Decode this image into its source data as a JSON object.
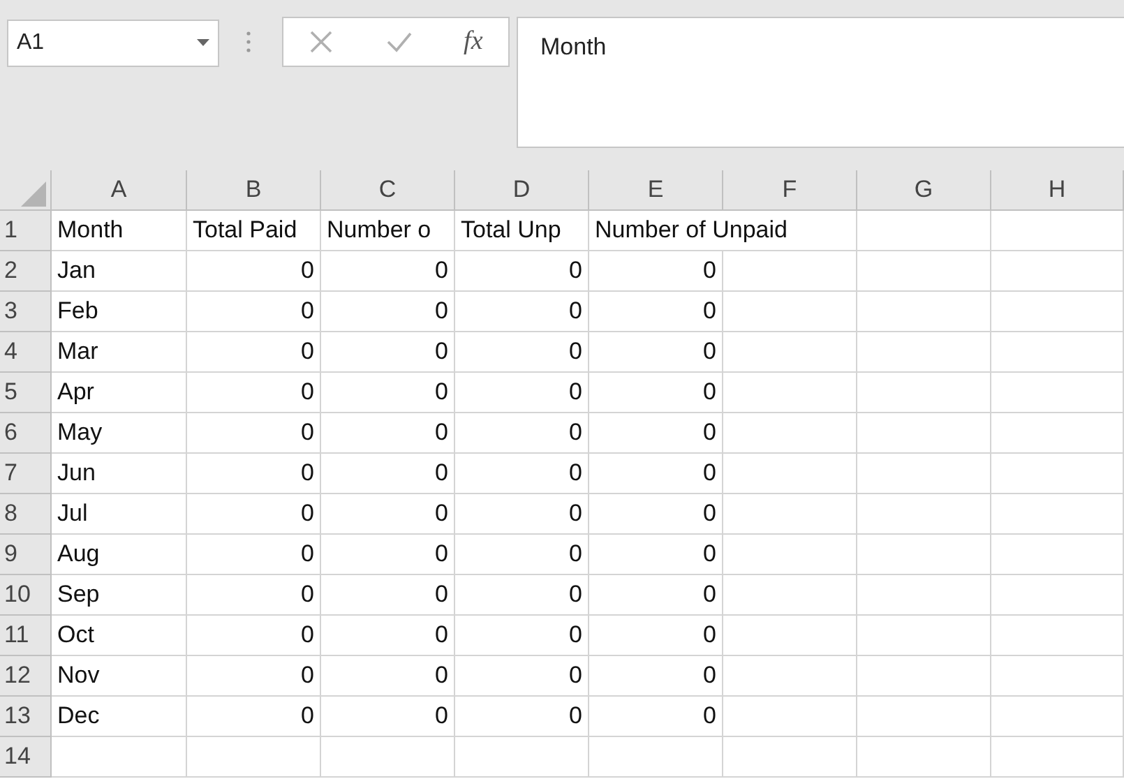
{
  "name_box": {
    "value": "A1"
  },
  "formula_bar": {
    "function_label": "fx",
    "value": "Month"
  },
  "columns": [
    "A",
    "B",
    "C",
    "D",
    "E",
    "F",
    "G",
    "H"
  ],
  "rows": [
    {
      "header": "1",
      "cells": [
        {
          "kind": "text",
          "value": "Month"
        },
        {
          "kind": "text",
          "value": "Total Paid"
        },
        {
          "kind": "text",
          "value": "Number o"
        },
        {
          "kind": "text",
          "value": "Total Unp"
        },
        {
          "kind": "text",
          "value": "Number of Unpaid"
        }
      ]
    },
    {
      "header": "2",
      "cells": [
        {
          "kind": "text",
          "value": "Jan"
        },
        {
          "kind": "number",
          "value": "0"
        },
        {
          "kind": "number",
          "value": "0"
        },
        {
          "kind": "number",
          "value": "0"
        },
        {
          "kind": "number",
          "value": "0"
        }
      ]
    },
    {
      "header": "3",
      "cells": [
        {
          "kind": "text",
          "value": "Feb"
        },
        {
          "kind": "number",
          "value": "0"
        },
        {
          "kind": "number",
          "value": "0"
        },
        {
          "kind": "number",
          "value": "0"
        },
        {
          "kind": "number",
          "value": "0"
        }
      ]
    },
    {
      "header": "4",
      "cells": [
        {
          "kind": "text",
          "value": "Mar"
        },
        {
          "kind": "number",
          "value": "0"
        },
        {
          "kind": "number",
          "value": "0"
        },
        {
          "kind": "number",
          "value": "0"
        },
        {
          "kind": "number",
          "value": "0"
        }
      ]
    },
    {
      "header": "5",
      "cells": [
        {
          "kind": "text",
          "value": "Apr"
        },
        {
          "kind": "number",
          "value": "0"
        },
        {
          "kind": "number",
          "value": "0"
        },
        {
          "kind": "number",
          "value": "0"
        },
        {
          "kind": "number",
          "value": "0"
        }
      ]
    },
    {
      "header": "6",
      "cells": [
        {
          "kind": "text",
          "value": "May"
        },
        {
          "kind": "number",
          "value": "0"
        },
        {
          "kind": "number",
          "value": "0"
        },
        {
          "kind": "number",
          "value": "0"
        },
        {
          "kind": "number",
          "value": "0"
        }
      ]
    },
    {
      "header": "7",
      "cells": [
        {
          "kind": "text",
          "value": "Jun"
        },
        {
          "kind": "number",
          "value": "0"
        },
        {
          "kind": "number",
          "value": "0"
        },
        {
          "kind": "number",
          "value": "0"
        },
        {
          "kind": "number",
          "value": "0"
        }
      ]
    },
    {
      "header": "8",
      "cells": [
        {
          "kind": "text",
          "value": "Jul"
        },
        {
          "kind": "number",
          "value": "0"
        },
        {
          "kind": "number",
          "value": "0"
        },
        {
          "kind": "number",
          "value": "0"
        },
        {
          "kind": "number",
          "value": "0"
        }
      ]
    },
    {
      "header": "9",
      "cells": [
        {
          "kind": "text",
          "value": "Aug"
        },
        {
          "kind": "number",
          "value": "0"
        },
        {
          "kind": "number",
          "value": "0"
        },
        {
          "kind": "number",
          "value": "0"
        },
        {
          "kind": "number",
          "value": "0"
        }
      ]
    },
    {
      "header": "10",
      "cells": [
        {
          "kind": "text",
          "value": "Sep"
        },
        {
          "kind": "number",
          "value": "0"
        },
        {
          "kind": "number",
          "value": "0"
        },
        {
          "kind": "number",
          "value": "0"
        },
        {
          "kind": "number",
          "value": "0"
        }
      ]
    },
    {
      "header": "11",
      "cells": [
        {
          "kind": "text",
          "value": "Oct"
        },
        {
          "kind": "number",
          "value": "0"
        },
        {
          "kind": "number",
          "value": "0"
        },
        {
          "kind": "number",
          "value": "0"
        },
        {
          "kind": "number",
          "value": "0"
        }
      ]
    },
    {
      "header": "12",
      "cells": [
        {
          "kind": "text",
          "value": "Nov"
        },
        {
          "kind": "number",
          "value": "0"
        },
        {
          "kind": "number",
          "value": "0"
        },
        {
          "kind": "number",
          "value": "0"
        },
        {
          "kind": "number",
          "value": "0"
        }
      ]
    },
    {
      "header": "13",
      "cells": [
        {
          "kind": "text",
          "value": "Dec"
        },
        {
          "kind": "number",
          "value": "0"
        },
        {
          "kind": "number",
          "value": "0"
        },
        {
          "kind": "number",
          "value": "0"
        },
        {
          "kind": "number",
          "value": "0"
        }
      ]
    },
    {
      "header": "14",
      "cells": []
    }
  ]
}
